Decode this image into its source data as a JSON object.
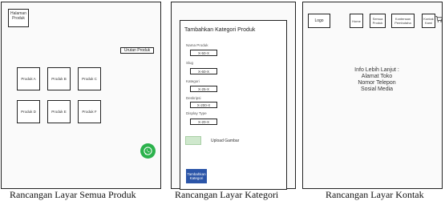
{
  "screen1": {
    "home_label": "Halaman Produk",
    "sort_label": "Urutan Produk",
    "products": [
      "Produk A",
      "Produk B",
      "Produk C",
      "Produk D",
      "Produk E",
      "Produk F"
    ],
    "whatsapp_icon": "whatsapp-icon",
    "caption": "Rancangan Layar Semua Produk"
  },
  "screen2": {
    "form_title": "Tambahkan Kategori Produk",
    "fields": [
      {
        "label": "Nama Produk",
        "value": "X-50-X"
      },
      {
        "label": "Slug",
        "value": "X-60-X"
      },
      {
        "label": "Kategori",
        "value": "X-25-X"
      },
      {
        "label": "Deskripsi",
        "value": "X-200-X"
      },
      {
        "label": "Display Type",
        "value": "X-20-X"
      }
    ],
    "upload_label": "Upload Gambar",
    "submit_label": "Tambahkan Kategori",
    "caption": "Rancangan Layar Kategori"
  },
  "screen3": {
    "logo": "Logo",
    "nav": {
      "home": "Home",
      "all_products": "Semua Produk",
      "contact": "Kontensan Pembutaha",
      "about": "Kontak Kami"
    },
    "cart_icon": "cart-icon",
    "info_lines": [
      "Info Lebih Lanjut :",
      "Alamat Toko",
      "Nomor Telepon",
      "Sosial Media"
    ],
    "caption": "Rancangan Layar Kontak"
  }
}
